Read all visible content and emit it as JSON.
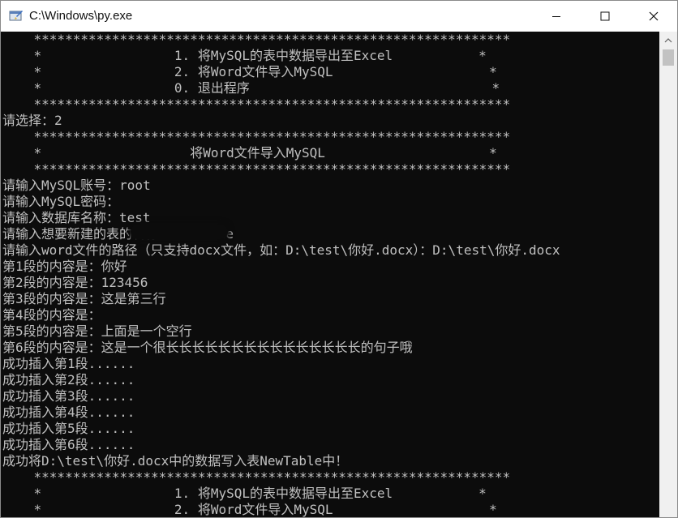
{
  "window": {
    "title": "C:\\Windows\\py.exe"
  },
  "console": {
    "lines": [
      "    *************************************************************",
      "    *                 1. 将MySQL的表中数据导出至Excel           *",
      "    *                 2. 将Word文件导入MySQL                    *",
      "    *                 0. 退出程序                               *",
      "    *************************************************************",
      "请选择：2",
      "    *************************************************************",
      "    *                   将Word文件导入MySQL                     *",
      "    *************************************************************",
      "请输入MySQL账号：root",
      "请输入MySQL密码：",
      "请输入数据库名称：test",
      "请输入想要新建的表的名称：NewTable",
      "请输入word文件的路径（只支持docx文件，如：D:\\test\\你好.docx）：D:\\test\\你好.docx",
      "第1段的内容是：你好",
      "第2段的内容是：123456",
      "第3段的内容是：这是第三行",
      "第4段的内容是：",
      "第5段的内容是：上面是一个空行",
      "第6段的内容是：这是一个很长长长长长长长长长长长长长长长的句子哦",
      "成功插入第1段......",
      "成功插入第2段......",
      "成功插入第3段......",
      "成功插入第4段......",
      "成功插入第5段......",
      "成功插入第6段......",
      "成功将D:\\test\\你好.docx中的数据写入表NewTable中！",
      "    *************************************************************",
      "    *                 1. 将MySQL的表中数据导出至Excel           *",
      "    *                 2. 将Word文件导入MySQL                    *"
    ]
  }
}
